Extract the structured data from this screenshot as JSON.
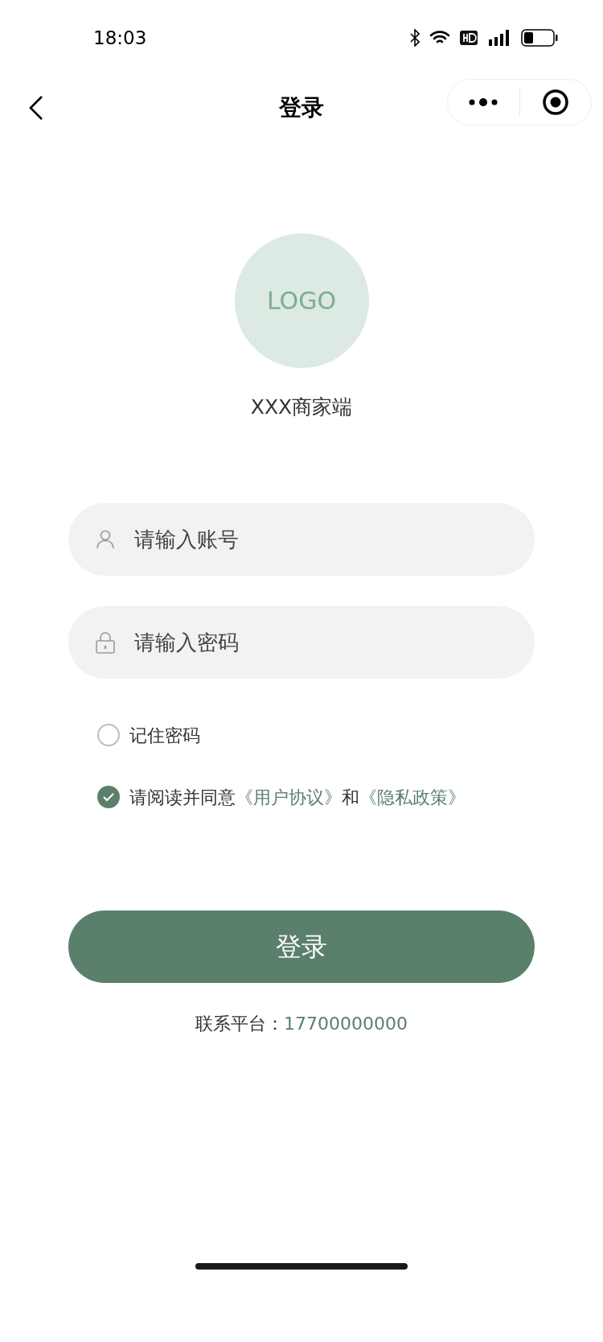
{
  "status_bar": {
    "time": "18:03"
  },
  "nav": {
    "title": "登录"
  },
  "logo": {
    "text": "LOGO"
  },
  "brand": "XXX商家端",
  "fields": [
    {
      "kind": "account",
      "placeholder": "请输入账号"
    },
    {
      "kind": "password",
      "placeholder": "请输入密码"
    }
  ],
  "remember": {
    "label": "记住密码",
    "checked": false
  },
  "agreement": {
    "checked": true,
    "text": "请阅读并同意",
    "link_1": "《用户协议》",
    "joiner": "和",
    "link_2": "《隐私政策》"
  },
  "login_button": "登录",
  "contact": {
    "label": "联系平台：",
    "phone": "17700000000"
  }
}
